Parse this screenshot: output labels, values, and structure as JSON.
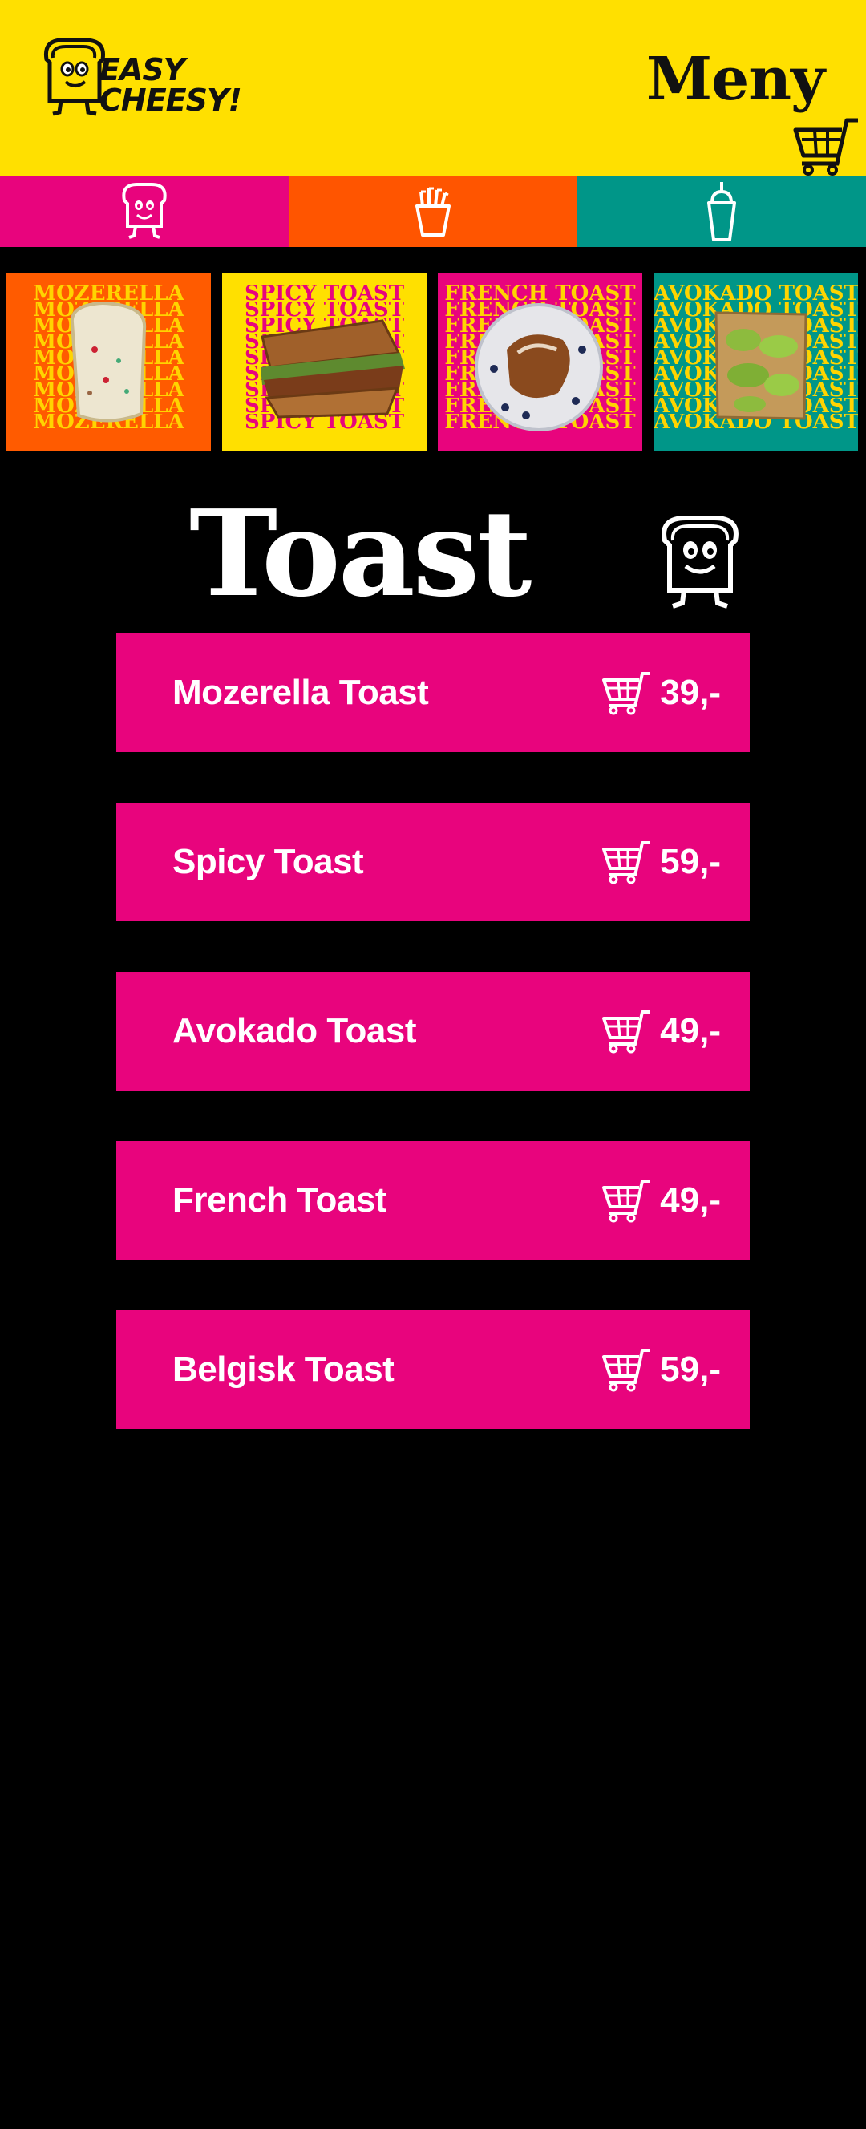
{
  "header": {
    "logo_line1": "EASY",
    "logo_line2": "CHEESY!",
    "title": "Meny",
    "bg_color": "#FFE000",
    "cart_icon": "cart-icon"
  },
  "categories": [
    {
      "icon": "toast-mascot-icon",
      "color": "#E8047D"
    },
    {
      "icon": "fries-icon",
      "color": "#FF5500"
    },
    {
      "icon": "smoothie-icon",
      "color": "#009688"
    }
  ],
  "carousel": [
    {
      "label": "MOZERELLA",
      "bg": "#FF5B00",
      "text_color": "#FFD400"
    },
    {
      "label": "SPICY TOAST",
      "bg": "#FFE000",
      "text_color": "#E8047D"
    },
    {
      "label": "FRENCH TOAST",
      "bg": "#E8047D",
      "text_color": "#FFD400"
    },
    {
      "label": "AVOKADO TOAST",
      "bg": "#009688",
      "text_color": "#FFD400"
    }
  ],
  "section": {
    "title": "Toast",
    "mascot_icon": "toast-mascot-icon"
  },
  "items": [
    {
      "name": "Mozerella Toast",
      "price": "39,-"
    },
    {
      "name": "Spicy Toast",
      "price": "59,-"
    },
    {
      "name": "Avokado Toast",
      "price": "49,-"
    },
    {
      "name": "French Toast",
      "price": "49,-"
    },
    {
      "name": "Belgisk Toast",
      "price": "59,-"
    }
  ],
  "colors": {
    "accent_pink": "#E8047D",
    "accent_orange": "#FF5500",
    "accent_teal": "#009688",
    "accent_yellow": "#FFE000",
    "background": "#000000"
  }
}
